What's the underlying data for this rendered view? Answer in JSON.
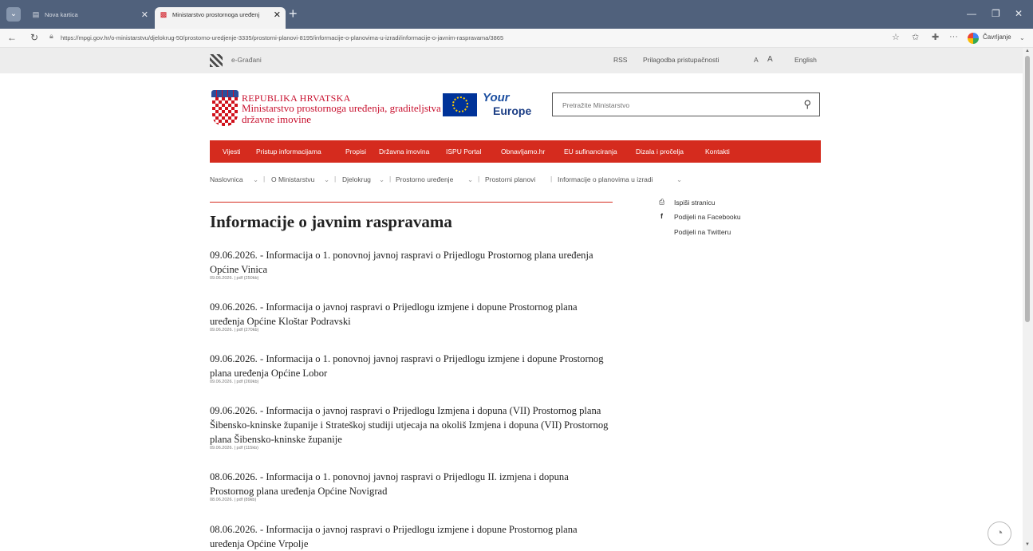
{
  "browser": {
    "tabs": [
      {
        "title": "Nova kartica"
      },
      {
        "title": "Ministarstvo prostornoga uređenj",
        "active": true
      }
    ],
    "new_tab_glyph": "+",
    "url": "https://mpgi.gov.hr/o-ministarstvu/djelokrug-50/prostorno-uredjenje-3335/prostorni-planovi-8195/informacije-o-planovima-u-izradi/informacije-o-javnim-raspravama/3865",
    "profile_label": "Čavrljanje",
    "more_glyph": "···"
  },
  "utility": {
    "egradani": "e-Građani",
    "rss": "RSS",
    "accessibility": "Prilagodba pristupačnosti",
    "font_small": "A",
    "font_large": "A",
    "english": "English"
  },
  "header": {
    "republic": "REPUBLIKA HRVATSKA",
    "ministry": "Ministarstvo prostornoga uređenja, graditeljstva i državne imovine",
    "your": "Your",
    "europe": "Europe",
    "search_placeholder": "Pretražite Ministarstvo"
  },
  "mainnav": [
    "Vijesti",
    "Pristup informacijama",
    "Propisi",
    "Državna imovina",
    "ISPU Portal",
    "Obnavljamo.hr",
    "EU sufinanciranja",
    "Dizala i pročelja",
    "Kontakti"
  ],
  "breadcrumb": [
    "Naslovnica",
    "O Ministarstvu",
    "Djelokrug",
    "Prostorno uređenje",
    "Prostorni planovi",
    "Informacije o planovima u izradi"
  ],
  "page_title": "Informacije o javnim raspravama",
  "sidebar": {
    "print": "Ispiši stranicu",
    "facebook": "Podijeli na Facebooku",
    "twitter": "Podijeli na Twitteru"
  },
  "items": [
    {
      "date": "09.06.2026.",
      "title": " - Informacija o 1. ponovnoj javnoj raspravi o Prijedlogu Prostornog plana uređenja Općine Vinica",
      "meta": "09.06.2026. | pdf (250kb)"
    },
    {
      "date": "09.06.2026.",
      "title": " - Informacija o javnoj raspravi o Prijedlogu izmjene i dopune Prostornog plana uređenja Općine Kloštar Podravski",
      "meta": "09.06.2026. | pdf (270kb)"
    },
    {
      "date": "09.06.2026.",
      "title": " - Informacija o 1. ponovnoj javnoj raspravi o Prijedlogu izmjene i dopune Prostornog plana uređenja Općine Lobor",
      "meta": "09.06.2026. | pdf (269kb)"
    },
    {
      "date": "09.06.2026.",
      "title": " - Informacija o javnoj raspravi o Prijedlogu Izmjena i dopuna (VII) Prostornog plana Šibensko-kninske županije i Strateškoj studiji utjecaja na okoliš Izmjena i dopuna (VII) Prostornog plana Šibensko-kninske županije",
      "meta": "09.06.2026. | pdf (115kb)"
    },
    {
      "date": "08.06.2026.",
      "title": " - Informacija o 1. ponovnoj javnoj raspravi o Prijedlogu II. izmjena i dopuna Prostornog plana uređenja Općine Novigrad",
      "meta": "08.06.2026. | pdf (89kb)"
    },
    {
      "date": "08.06.2026.",
      "title": " - Informacija o javnoj raspravi o Prijedlogu izmjene i dopune Prostornog plana uređenja Općine Vrpolje",
      "meta": ""
    }
  ]
}
